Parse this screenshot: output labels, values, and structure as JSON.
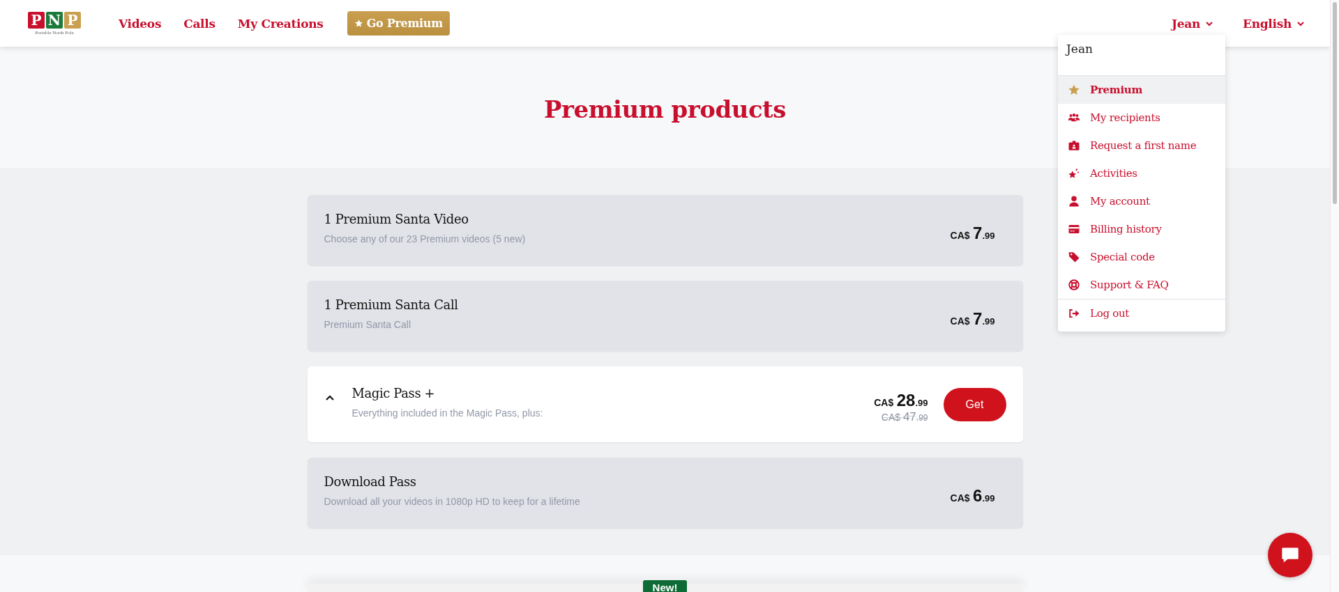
{
  "header": {
    "logo": {
      "letters": [
        "P",
        "N",
        "P"
      ],
      "tagline": "Portable North Pole"
    },
    "nav": [
      {
        "label": "Videos"
      },
      {
        "label": "Calls"
      },
      {
        "label": "My Creations"
      }
    ],
    "premium_button": {
      "label": "Go Premium"
    },
    "user_menu": {
      "label": "Jean",
      "expanded": true
    },
    "language_menu": {
      "label": "English"
    }
  },
  "user_dropdown": {
    "name": "Jean",
    "items": [
      {
        "label": "Premium",
        "selected": true
      },
      {
        "label": "My recipients",
        "selected": false
      },
      {
        "label": "Request a first name",
        "selected": false
      },
      {
        "label": "Activities",
        "selected": false
      },
      {
        "label": "My account",
        "selected": false
      },
      {
        "label": "Billing history",
        "selected": false
      },
      {
        "label": "Special code",
        "selected": false
      },
      {
        "label": "Support & FAQ",
        "selected": false
      }
    ],
    "logout": {
      "label": "Log out"
    }
  },
  "hero": {
    "title": "Premium products"
  },
  "products": [
    {
      "kind": "simple",
      "title": "1 Premium Santa Video",
      "description": "Choose any of our 23 Premium videos (5 new)",
      "price": {
        "currency": "CA$",
        "amount": "7",
        "cents": ".99"
      }
    },
    {
      "kind": "simple",
      "title": "1 Premium Santa Call",
      "description": "Premium Santa Call",
      "price": {
        "currency": "CA$",
        "amount": "7",
        "cents": ".99"
      }
    },
    {
      "kind": "pass",
      "expanded": true,
      "title": "Magic Pass +",
      "description": "Everything included in the Magic Pass, plus:",
      "price": {
        "currency": "CA$",
        "amount": "28",
        "cents": ".99"
      },
      "old_price": {
        "currency": "CA$",
        "amount": "47",
        "cents": ".99"
      },
      "button": "Get"
    },
    {
      "kind": "simple",
      "title": "Download Pass",
      "description": "Download all your videos in 1080p HD to keep for a lifetime",
      "price": {
        "currency": "CA$",
        "amount": "6",
        "cents": ".99"
      }
    }
  ],
  "promo": {
    "badge": "New!"
  }
}
